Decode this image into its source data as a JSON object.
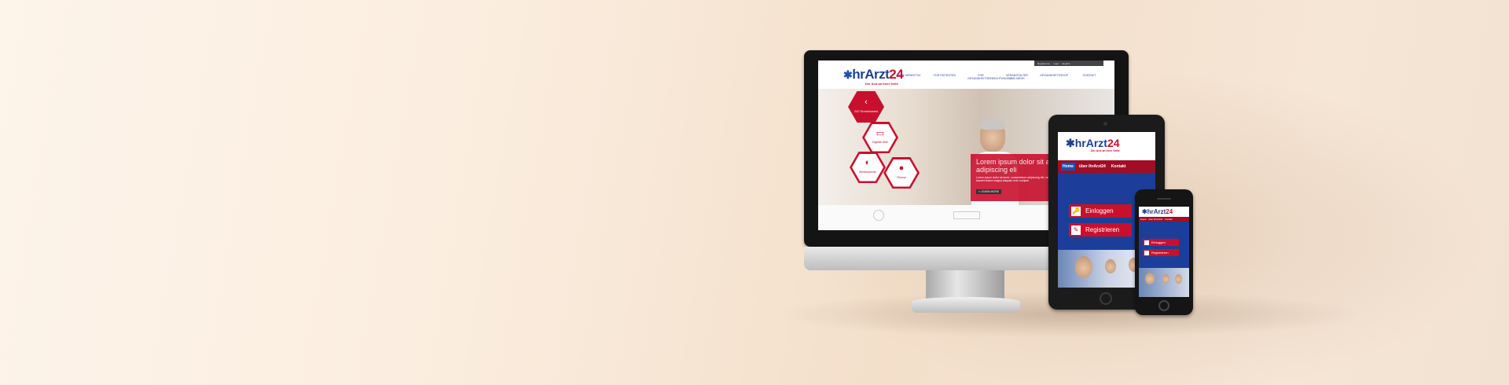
{
  "desktop": {
    "topbar": [
      "Registrieren",
      "Login",
      "English"
    ],
    "logo": {
      "star": "✱",
      "name": "hrArzt",
      "num": "24",
      "tagline": "Der Arzt an Ihrer Seite"
    },
    "nav": [
      "ÜBER IHRARZT24",
      "FÜR PATIENTEN",
      "FÜR GESUNDHEITSEINRICHTUNGEN",
      "VERANSTALTER UND MEHR",
      "GESUNDHEITSSHOP",
      "KONTAKT"
    ],
    "hexes": [
      {
        "icon": "‹",
        "label": "24/7 Erreichbarkeit"
      },
      {
        "icon": "▭",
        "label": "Digitale Akte"
      },
      {
        "icon": "◐",
        "label": "Medikamente"
      },
      {
        "icon": "●",
        "label": "Fitness"
      }
    ],
    "hero": {
      "headline": "Lorem ipsum dolor sit amet, consectetuer adipiscing eli",
      "body": "Lorem ipsum dolor sit amet, consectetuer adipiscing elit, sed diam nonummy nibh euismod tincidunt ut laoreet dolore magna aliquam erat volutpat.",
      "button": "» LEARN MORE"
    }
  },
  "tablet": {
    "logo": {
      "star": "✱",
      "name": "hrArzt",
      "num": "24",
      "tagline": "Der Arzt an Ihrer Seite"
    },
    "nav": [
      "Home",
      "über IhrArzt24",
      "Kontakt"
    ],
    "buttons": [
      {
        "icon": "🔑",
        "label": "Einloggen"
      },
      {
        "icon": "✎",
        "label": "Registrieren"
      }
    ]
  },
  "phone": {
    "logo": {
      "star": "✱",
      "name": "hrArzt",
      "num": "24"
    },
    "nav": [
      "Home",
      "über IhrArzt24",
      "Kontakt"
    ],
    "buttons": [
      {
        "label": "Einloggen"
      },
      {
        "label": "Registrieren"
      }
    ]
  },
  "colors": {
    "brand_red": "#c8102e",
    "brand_blue": "#1f3f8f"
  }
}
